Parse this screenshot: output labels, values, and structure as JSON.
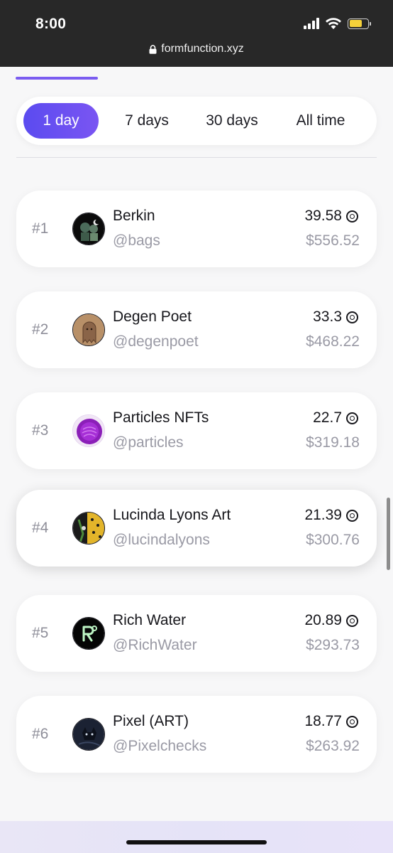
{
  "status_bar": {
    "time": "8:00",
    "url": "formfunction.xyz"
  },
  "filters": {
    "items": [
      "1 day",
      "7 days",
      "30 days",
      "All time"
    ],
    "selected": "1 day",
    "accent": "#5b4bf0"
  },
  "leaderboard": [
    {
      "rank": "#1",
      "name": "Berkin",
      "handle": "@bags",
      "amount": "39.58",
      "usd": "$556.52"
    },
    {
      "rank": "#2",
      "name": "Degen Poet",
      "handle": "@degenpoet",
      "amount": "33.3",
      "usd": "$468.22"
    },
    {
      "rank": "#3",
      "name": "Particles NFTs",
      "handle": "@particles",
      "amount": "22.7",
      "usd": "$319.18"
    },
    {
      "rank": "#4",
      "name": "Lucinda Lyons Art",
      "handle": "@lucindalyons",
      "amount": "21.39",
      "usd": "$300.76"
    },
    {
      "rank": "#5",
      "name": "Rich Water",
      "handle": "@RichWater",
      "amount": "20.89",
      "usd": "$293.73"
    },
    {
      "rank": "#6",
      "name": "Pixel (ART)",
      "handle": "@Pixelchecks",
      "amount": "18.77",
      "usd": "$263.92"
    }
  ]
}
